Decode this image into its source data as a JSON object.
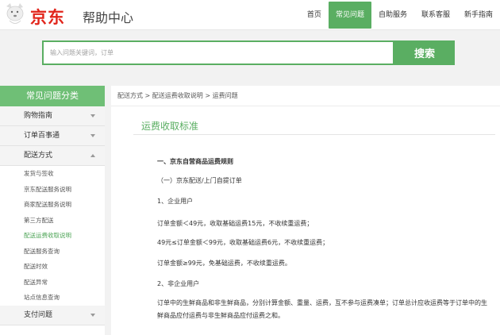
{
  "header": {
    "logo_text": "京东",
    "site_title": "帮助中心",
    "nav": [
      "首页",
      "常见问题",
      "自助服务",
      "联系客服",
      "新手指南"
    ],
    "active_nav": 1
  },
  "search": {
    "placeholder": "输入问题关键词，订单",
    "button_label": "搜索"
  },
  "sidebar": {
    "heading": "常见问题分类",
    "categories": [
      {
        "label": "购物指南"
      },
      {
        "label": "订单百事通"
      },
      {
        "label": "配送方式"
      }
    ],
    "subitems": [
      "发货与签收",
      "京东配送服务说明",
      "商家配送服务说明",
      "第三方配送",
      "配送运费收取说明",
      "配送服务查询",
      "配送时效",
      "配送异常",
      "站点信息查询"
    ],
    "active_subitem": 4,
    "bottom_category": "支付问题"
  },
  "breadcrumb": "配送方式 > 配送运费收取说明 > 运费问题",
  "content": {
    "title": "运费收取标准",
    "section_heading": "一、京东自营商品运费规则",
    "sub_heading": "（一）京东配送/上门自提订单",
    "item_1": "1、企业用户",
    "rule_1": "订单金额＜49元，收取基础运费15元，不收续重运费；",
    "rule_2": "49元≤订单金额＜99元，收取基础运费6元，不收续重运费；",
    "rule_3": "订单金额≥99元，免基础运费，不收续重运费。",
    "item_2": "2、非企业用户",
    "paragraph": "订单中的生鲜商品和非生鲜商品，分别计算金额、重量、运费，互不参与运费凑单；订单总计应收运费等于订单中的生鲜商品应付运费与非生鲜商品应付运费之和。"
  },
  "colors": {
    "brand_green": "#5aae62",
    "logo_red": "#e1251b"
  }
}
